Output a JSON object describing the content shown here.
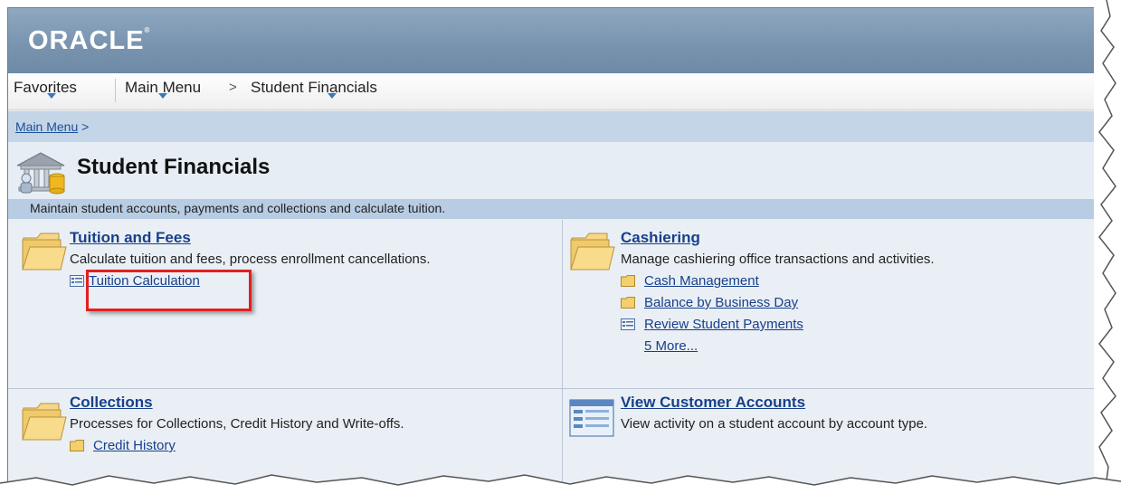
{
  "header": {
    "logo": "ORACLE",
    "logo_mark": "®"
  },
  "menubar": {
    "favorites": "Favorites",
    "main_menu": "Main Menu",
    "separator": ">",
    "student_financials": "Student Financials"
  },
  "breadcrumb": {
    "main_menu": "Main Menu",
    "separator": ">"
  },
  "page": {
    "title": "Student Financials",
    "description": "Maintain student accounts, payments and collections and calculate tuition."
  },
  "sections": {
    "tuition": {
      "title": "Tuition and Fees",
      "description": "Calculate tuition and fees, process enrollment cancellations.",
      "links": [
        "Tuition Calculation"
      ]
    },
    "cashiering": {
      "title": "Cashiering",
      "description": "Manage cashiering office transactions and activities.",
      "links": [
        "Cash Management",
        "Balance by Business Day",
        "Review Student Payments",
        "5 More..."
      ]
    },
    "collections": {
      "title": "Collections",
      "description": "Processes for Collections, Credit History and Write-offs.",
      "links": [
        "Credit History"
      ]
    },
    "customer_accounts": {
      "title": "View Customer Accounts",
      "description": "View activity on a student account by account type."
    }
  },
  "icons": {
    "folder": "folder-icon",
    "component": "component-icon",
    "highlight_color": "#e02020"
  }
}
